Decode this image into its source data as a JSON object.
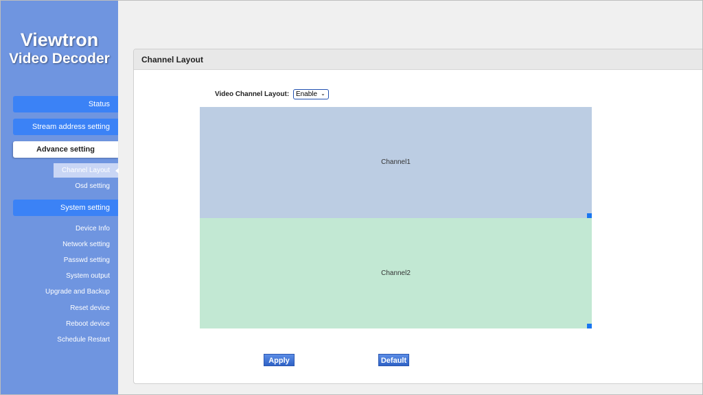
{
  "brand": {
    "line1": "Viewtron",
    "line2": "Video Decoder"
  },
  "sidebar": {
    "status": "Status",
    "stream_address": "Stream address setting",
    "advance": "Advance setting",
    "advance_items": {
      "channel_layout": "Channel Layout",
      "osd": "Osd setting"
    },
    "system": "System setting",
    "system_items": [
      "Device Info",
      "Network setting",
      "Passwd setting",
      "System output",
      "Upgrade and Backup",
      "Reset device",
      "Reboot device",
      "Schedule Restart"
    ]
  },
  "panel": {
    "title": "Channel Layout",
    "layout_label": "Video Channel Layout:",
    "layout_value": "Enable",
    "channels": [
      "Channel1",
      "Channel2"
    ],
    "apply_label": "Apply",
    "default_label": "Default"
  },
  "colors": {
    "sidebar_bg": "#6f95e0",
    "nav_button": "#3b82f6",
    "channel1_bg": "#bccde3",
    "channel2_bg": "#c2e8d3",
    "resize_handle": "#1976f0"
  },
  "icons": {
    "select_chevron": "chevron-down-icon",
    "active_caret": "caret-left-icon",
    "resize_handle": "resize-handle-icon"
  }
}
